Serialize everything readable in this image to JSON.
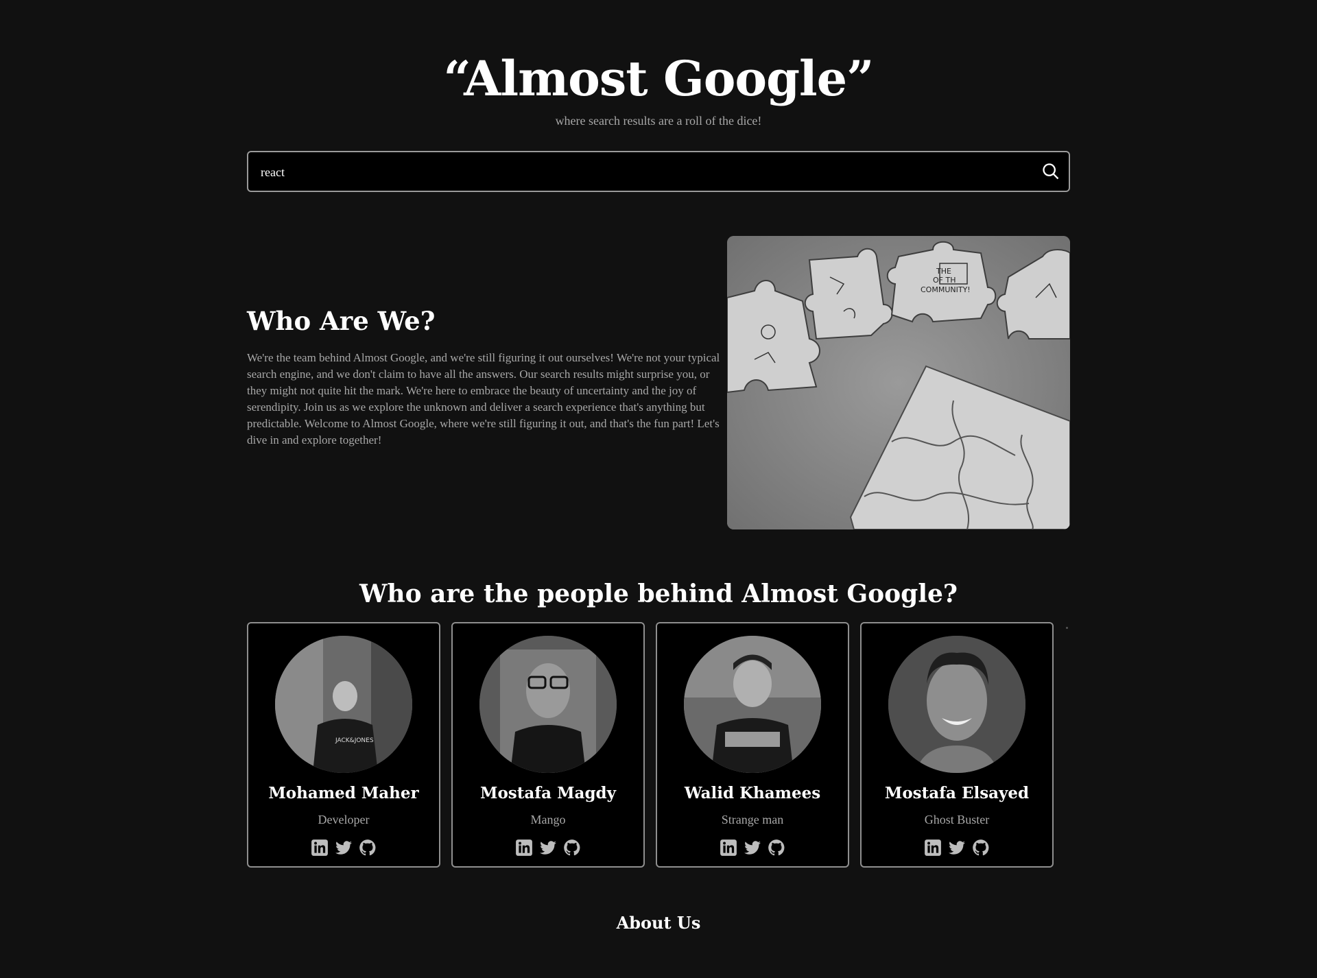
{
  "header": {
    "title": "“Almost Google”",
    "subtitle": "where search results are a roll of the dice!"
  },
  "search": {
    "value": "react",
    "icon": "search-icon"
  },
  "who": {
    "title": "Who Are We?",
    "text": "We're the team behind Almost Google, and we're still figuring it out ourselves! We're not your typical search engine, and we don't claim to have all the answers. Our search results might surprise you, or they might not quite hit the mark. We're here to embrace the beauty of uncertainty and the joy of serendipity. Join us as we explore the unknown and deliver a search experience that's anything but predictable. Welcome to Almost Google, where we're still figuring it out, and that's the fun part! Let's dive in and explore together!",
    "image_text": "THE PIL OF TH COMMUNITY!"
  },
  "people": {
    "title": "Who are the people behind Almost Google?",
    "members": [
      {
        "name": "Mohamed Maher",
        "role": "Developer"
      },
      {
        "name": "Mostafa Magdy",
        "role": "Mango"
      },
      {
        "name": "Walid Khamees",
        "role": "Strange man"
      },
      {
        "name": "Mostafa Elsayed",
        "role": "Ghost Buster"
      }
    ],
    "social_icons": [
      "linkedin-icon",
      "twitter-icon",
      "github-icon"
    ]
  },
  "footer": {
    "about": "About Us"
  },
  "colors": {
    "background": "#111111",
    "card": "#000000",
    "border": "#8f8f8f",
    "muted_text": "#a8a8a8"
  }
}
